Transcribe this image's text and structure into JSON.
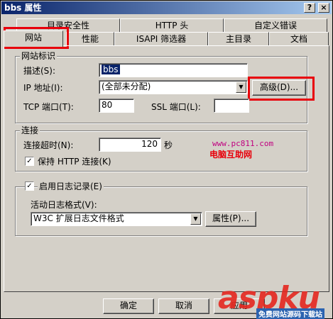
{
  "window": {
    "title": "bbs 属性",
    "help_btn": "?",
    "close_btn": "×"
  },
  "tabs_back": [
    "目录安全性",
    "HTTP 头",
    "自定义错误"
  ],
  "tabs_front": [
    "网站",
    "性能",
    "ISAPI 筛选器",
    "主目录",
    "文档"
  ],
  "site_id": {
    "legend": "网站标识",
    "desc_label": "描述(S):",
    "desc_value": "bbs",
    "ip_label": "IP 地址(I):",
    "ip_value": "(全部未分配)",
    "advanced_btn": "高级(D)...",
    "tcp_label": "TCP 端口(T):",
    "tcp_value": "80",
    "ssl_label": "SSL 端口(L):",
    "ssl_value": ""
  },
  "connection": {
    "legend": "连接",
    "timeout_label": "连接超时(N):",
    "timeout_value": "120",
    "timeout_unit": "秒",
    "keepalive_label": "保持 HTTP 连接(K)",
    "keepalive_checked": "✓"
  },
  "logging": {
    "enable_label": "启用日志记录(E)",
    "enable_checked": "✓",
    "format_label": "活动日志格式(V):",
    "format_value": "W3C 扩展日志文件格式",
    "props_btn": "属性(P)..."
  },
  "watermark": {
    "url": "www.pc811.com",
    "name": "电脑互助网",
    "logo": "aspku",
    "logo_sub": "免费网站源码下载站"
  },
  "footer": {
    "ok": "确定",
    "cancel": "取消",
    "apply": "应用"
  },
  "colors": {
    "highlight_red": "#e8000b",
    "selection_blue": "#0a246a"
  }
}
